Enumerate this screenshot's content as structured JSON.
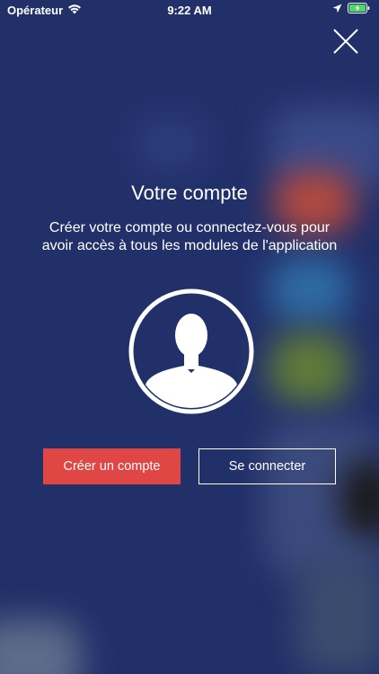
{
  "status_bar": {
    "carrier": "Opérateur",
    "time": "9:22 AM"
  },
  "modal": {
    "title": "Votre compte",
    "description_line1": "Créer votre compte ou connectez-vous pour",
    "description_line2": "avoir accès à tous les modules de l'application",
    "create_account_label": "Créer un compte",
    "login_label": "Se connecter"
  },
  "icons": {
    "close": "close-icon",
    "avatar": "user-avatar-icon",
    "wifi": "wifi-icon",
    "location": "location-arrow-icon",
    "battery": "battery-charging-icon"
  },
  "colors": {
    "background": "#22306a",
    "primary_button": "#e04644",
    "battery_fill": "#4cd964"
  }
}
